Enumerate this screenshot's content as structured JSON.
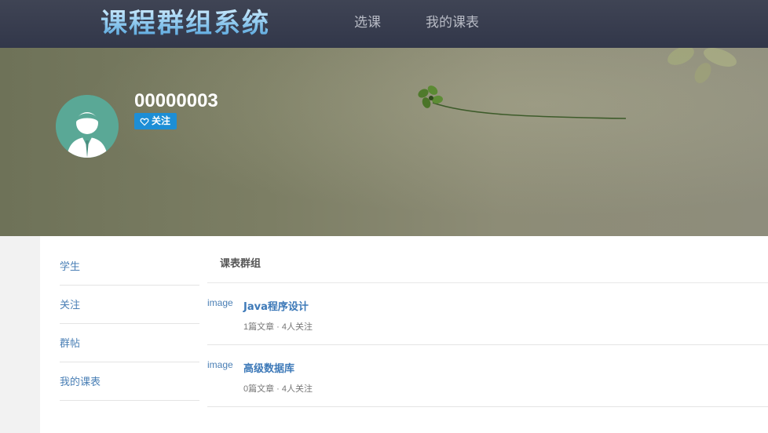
{
  "header": {
    "logo": "课程群组系统",
    "nav": [
      {
        "label": "选课"
      },
      {
        "label": "我的课表"
      }
    ]
  },
  "profile": {
    "username": "00000003",
    "follow_label": "关注"
  },
  "sidebar": {
    "items": [
      {
        "label": "学生"
      },
      {
        "label": "关注"
      },
      {
        "label": "群帖"
      },
      {
        "label": "我的课表"
      }
    ]
  },
  "main": {
    "title": "课表群组",
    "groups": [
      {
        "image_alt": "image",
        "name": "Java程序设计",
        "meta": "1篇文章 · 4人关注"
      },
      {
        "image_alt": "image",
        "name": "高级数据库",
        "meta": "0篇文章 · 4人关注"
      }
    ]
  },
  "colors": {
    "nav_bg": "#363b4d",
    "follow_button": "#1d8ed6",
    "link": "#3d79b8",
    "avatar_bg": "#5aa896"
  },
  "icons": {
    "follow": "heart-icon",
    "avatar": "user-avatar-icon"
  }
}
